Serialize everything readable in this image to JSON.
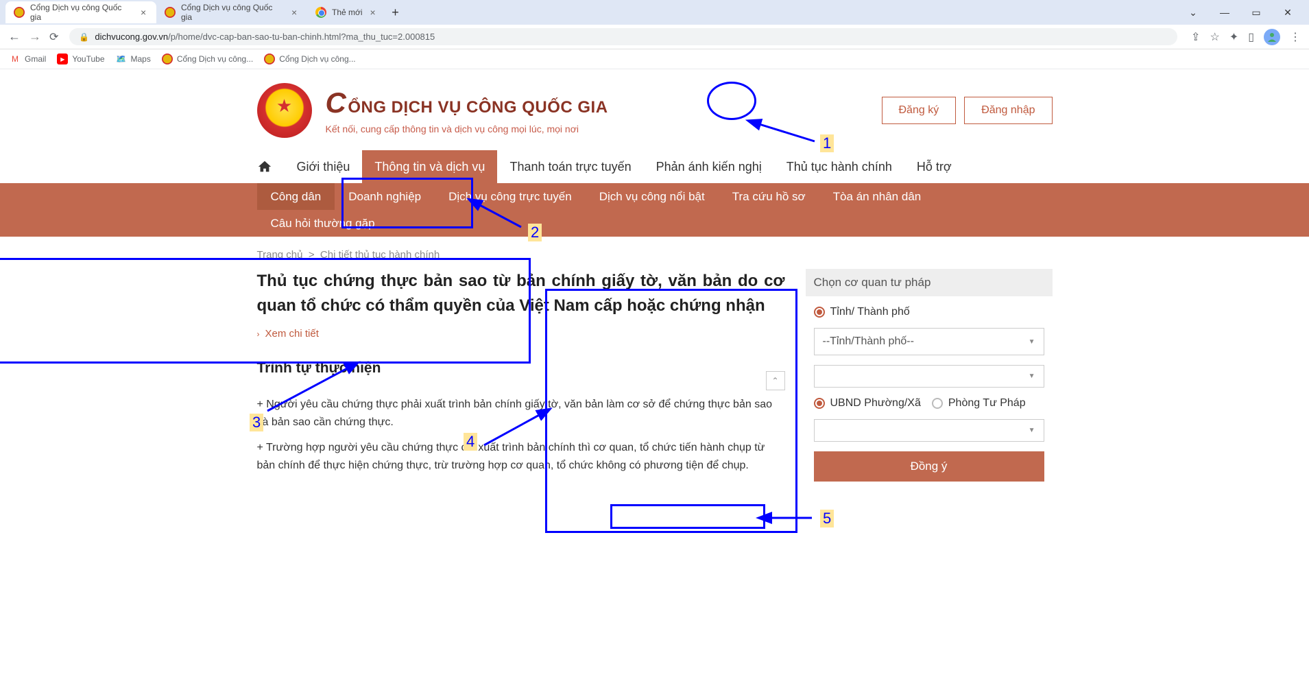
{
  "browser": {
    "tabs": [
      {
        "title": "Cổng Dịch vụ công Quốc gia",
        "active": true
      },
      {
        "title": "Cổng Dịch vụ công Quốc gia",
        "active": false
      },
      {
        "title": "Thẻ mới",
        "active": false
      }
    ],
    "url_prefix": "dichvucong.gov.vn",
    "url_rest": "/p/home/dvc-cap-ban-sao-tu-ban-chinh.html?ma_thu_tuc=2.000815",
    "bookmarks": [
      "Gmail",
      "YouTube",
      "Maps",
      "Cổng Dịch vụ công...",
      "Cổng Dịch vụ công..."
    ]
  },
  "header": {
    "site_title": "ỔNG DỊCH VỤ CÔNG QUỐC GIA",
    "tagline": "Kết nối, cung cấp thông tin và dịch vụ công mọi lúc, mọi nơi",
    "register": "Đăng ký",
    "login": "Đăng nhập"
  },
  "mainnav": {
    "items": [
      "Giới thiệu",
      "Thông tin và dịch vụ",
      "Thanh toán trực tuyến",
      "Phản ánh kiến nghị",
      "Thủ tục hành chính",
      "Hỗ trợ"
    ],
    "active_index": 1
  },
  "subnav": {
    "items": [
      "Công dân",
      "Doanh nghiệp",
      "Dịch vụ công trực tuyến",
      "Dịch vụ công nổi bật",
      "Tra cứu hồ sơ",
      "Tòa án nhân dân",
      "Câu hỏi thường gặp"
    ],
    "active_index": 0
  },
  "breadcrumb": {
    "home": "Trang chủ",
    "current": "Chi tiết thủ tục hành chính"
  },
  "content": {
    "title": "Thủ tục chứng thực bản sao từ bản chính giấy tờ, văn bản do cơ quan tổ chức có thẩm quyền của Việt Nam cấp hoặc chứng nhận",
    "see_more": "Xem chi tiết",
    "section1_title": "Trình tự thực hiện",
    "para1": "+ Người yêu cầu chứng thực phải xuất trình bản chính giấy tờ, văn bản làm cơ sở để chứng thực bản sao và bản sao cần chứng thực.",
    "para2": "+ Trường hợp người yêu cầu chứng thực chỉ xuất trình bản chính thì cơ quan, tổ chức tiến hành chụp từ bản chính để thực hiện chứng thực, trừ trường hợp cơ quan, tổ chức không có phương tiện để chụp."
  },
  "sidebar": {
    "title": "Chọn cơ quan tư pháp",
    "opt_province": "Tỉnh/ Thành phố",
    "select1_placeholder": "--Tỉnh/Thành phố--",
    "select2_placeholder": "",
    "opt_ward": "UBND Phường/Xã",
    "opt_dept": "Phòng Tư Pháp",
    "select3_placeholder": "",
    "submit": "Đồng ý"
  },
  "annotations": {
    "n1": "1",
    "n2": "2",
    "n3": "3",
    "n4": "4",
    "n5": "5"
  }
}
